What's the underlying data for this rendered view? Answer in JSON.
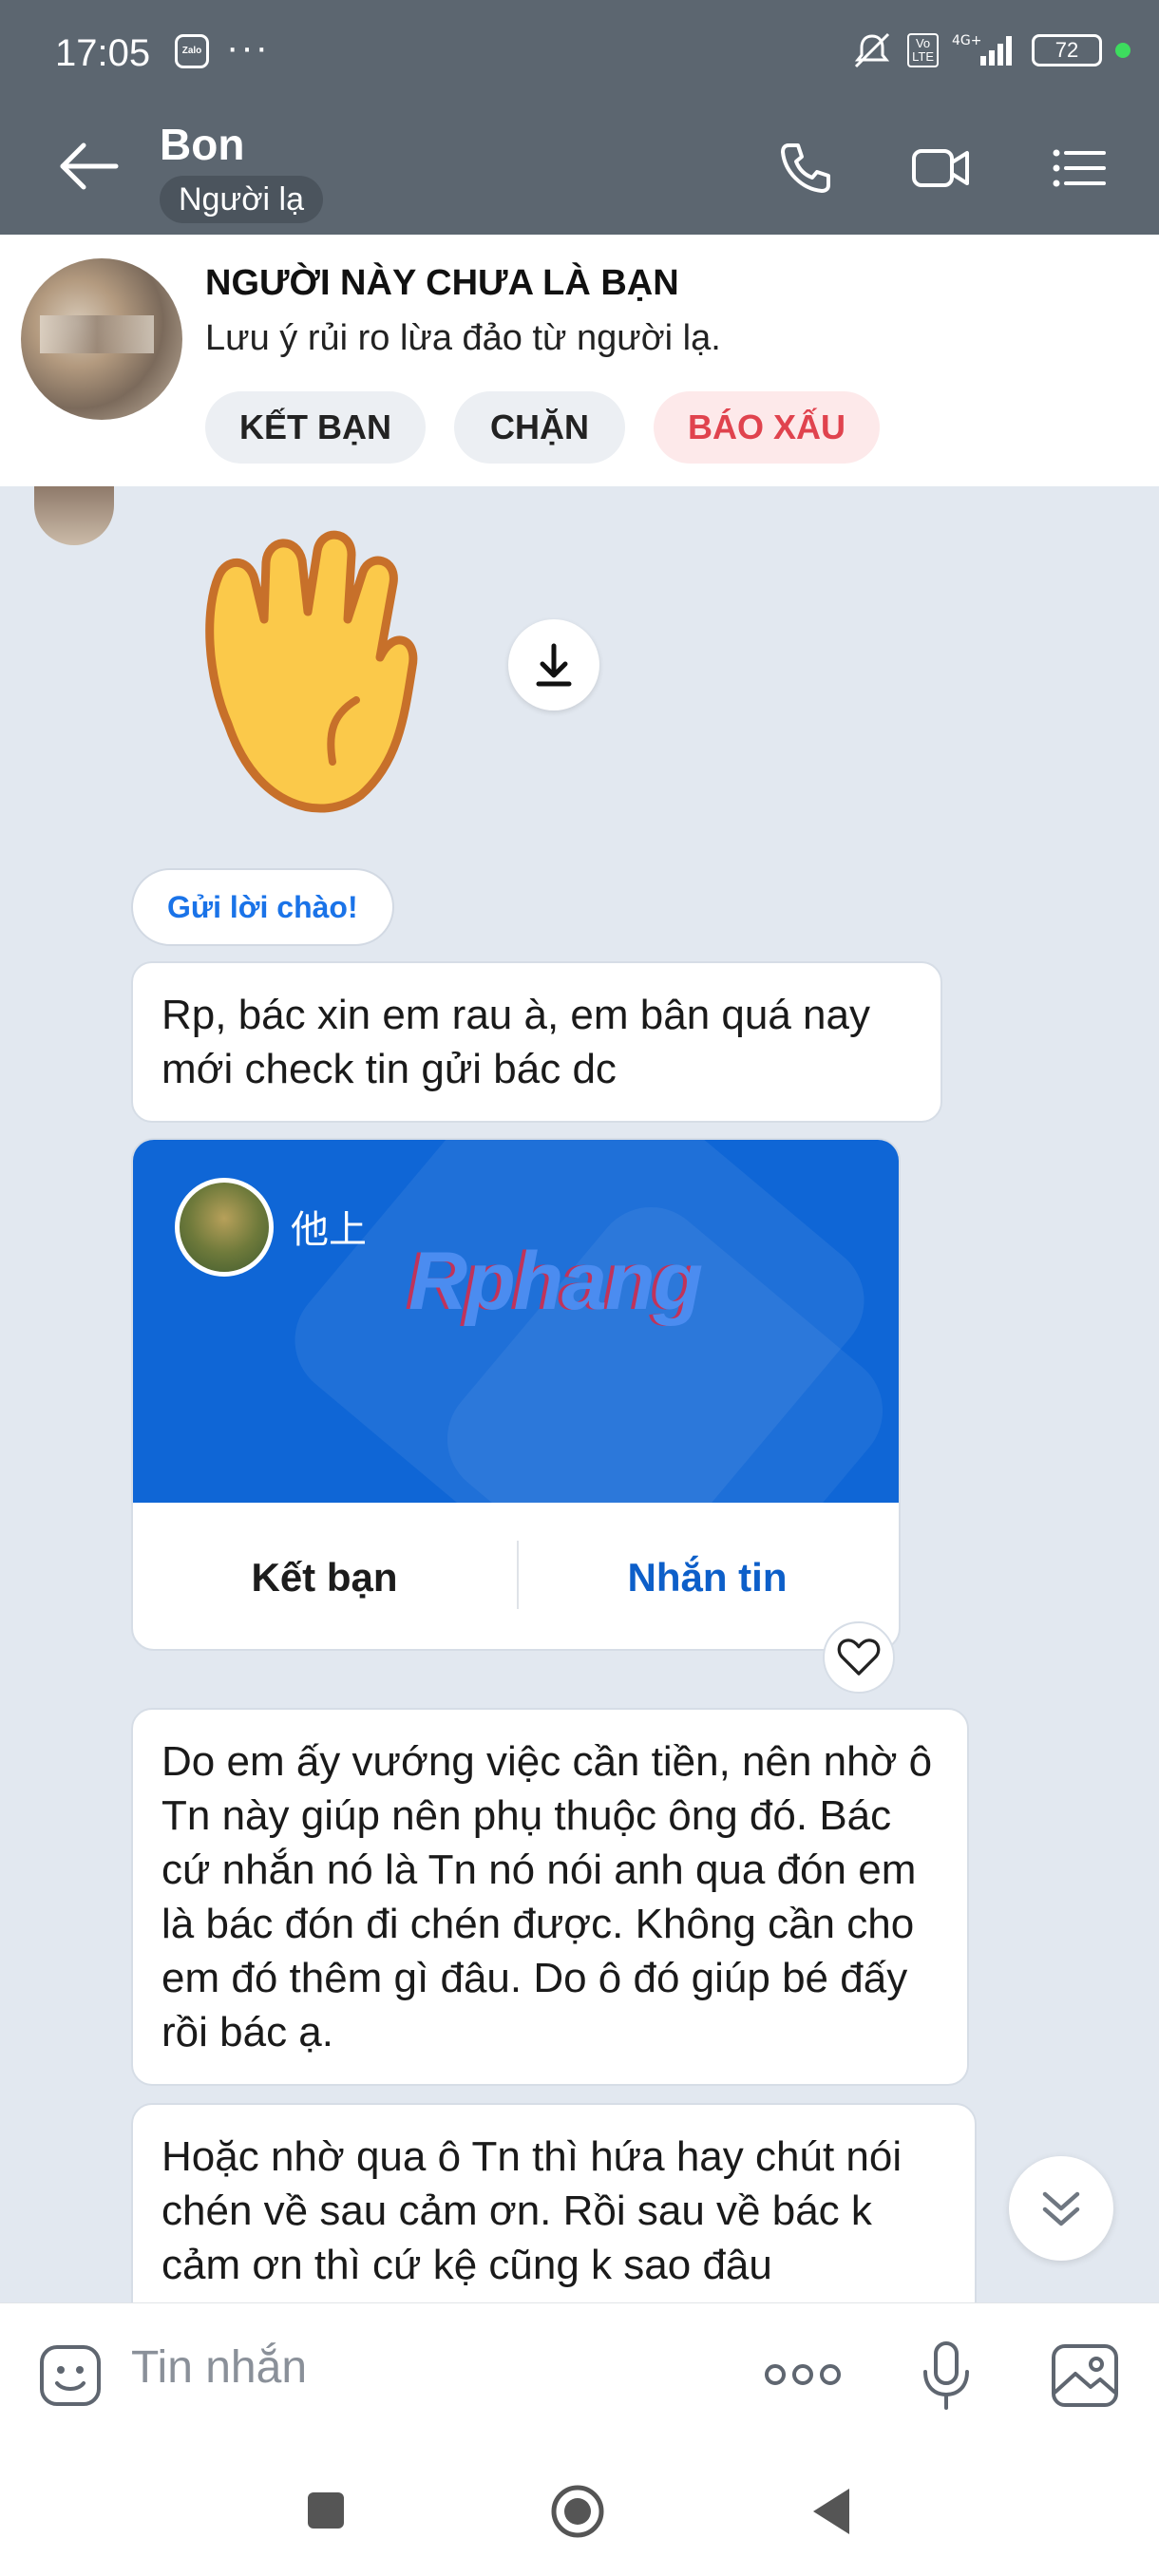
{
  "status_bar": {
    "time": "17:05",
    "app_badge": "Zalo",
    "more": "···",
    "volte": "Vo\nLTE",
    "network": "4G+",
    "battery": "72",
    "dot_color": "#3ddc5e"
  },
  "header": {
    "name": "Bon",
    "tag": "Người lạ"
  },
  "stranger_banner": {
    "title": "NGƯỜI NÀY CHƯA LÀ BẠN",
    "warning": "Lưu ý rủi ro lừa đảo từ người lạ.",
    "add_friend_label": "KẾT BẠN",
    "block_label": "CHẶN",
    "report_label": "BÁO XẤU"
  },
  "chat": {
    "greeting_chip": "Gửi lời chào!",
    "message_1": "Rp, bác xin em rau à, em bân quá nay mới check tin gửi bác dc",
    "contact_card": {
      "name": "他上",
      "watermark": "Rphang",
      "add_friend_label": "Kết bạn",
      "message_label": "Nhắn tin"
    },
    "message_2": "Do em ấy vướng việc cần tiền, nên nhờ ô Tn này giúp nên phụ thuộc ông đó. Bác cứ nhắn nó là Tn nó nói anh qua đón em là bác đón đi chén được. Không cần cho em đó thêm gì đâu. Do ô đó giúp bé đấy rồi bác ạ.",
    "message_3": "Hoặc nhờ qua ô Tn thì hứa hay chút nói chén về sau cảm ơn. Rồi sau về bác k cảm ơn thì cứ kệ cũng k sao đâu"
  },
  "input": {
    "placeholder": "Tin nhắn"
  },
  "colors": {
    "header_bg": "#5c6670",
    "chat_bg": "#e2e8f0",
    "accent_blue": "#1a73e8",
    "card_blue": "#0f66d6",
    "report_red": "#e0434e"
  }
}
